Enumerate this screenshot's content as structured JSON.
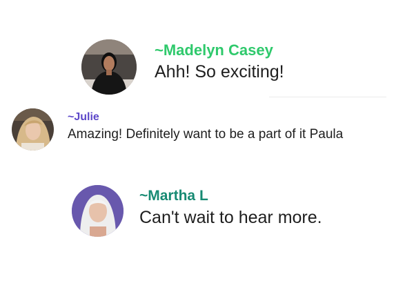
{
  "messages": [
    {
      "sender": "~Madelyn Casey",
      "text": "Ahh! So exciting!",
      "sender_color": "#2fc96c"
    },
    {
      "sender": "~Julie",
      "text": "Amazing! Definitely want to be a part of it Paula",
      "sender_color": "#5c47c9"
    },
    {
      "sender": "~Martha L",
      "text": "Can't wait to hear more.",
      "sender_color": "#178a73"
    }
  ],
  "avatar_icon": "user-photo-avatar"
}
